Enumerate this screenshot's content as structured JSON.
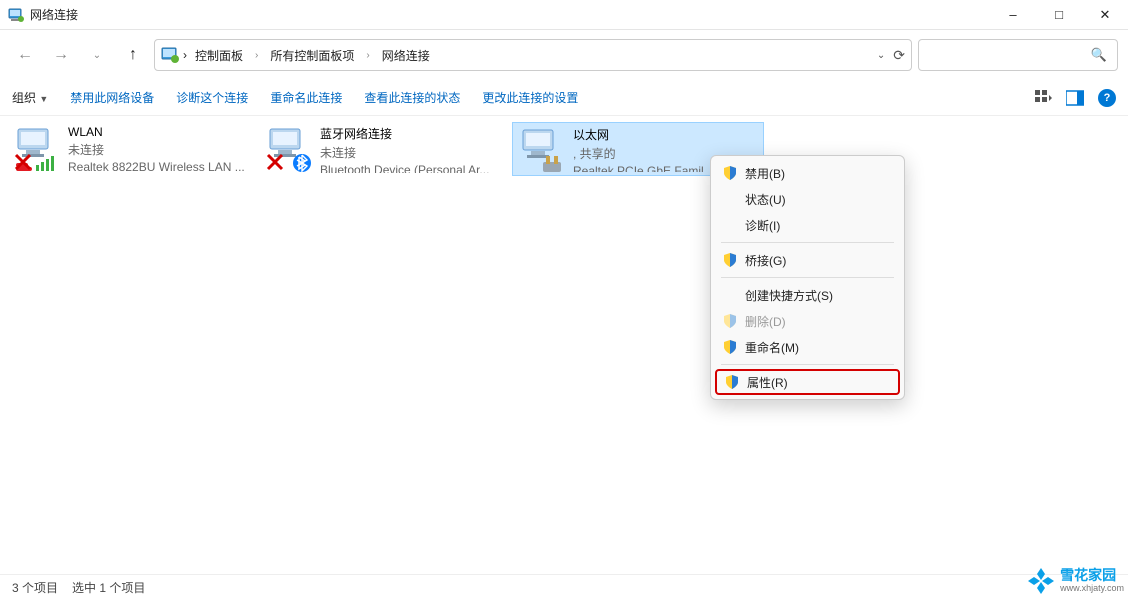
{
  "window": {
    "title": "网络连接"
  },
  "breadcrumb": {
    "root": "控制面板",
    "mid": "所有控制面板项",
    "leaf": "网络连接"
  },
  "toolbar": {
    "organize": "组织",
    "disable": "禁用此网络设备",
    "diagnose": "诊断这个连接",
    "rename": "重命名此连接",
    "status": "查看此连接的状态",
    "settings": "更改此连接的设置"
  },
  "connections": [
    {
      "name": "WLAN",
      "status": "未连接",
      "device": "Realtek 8822BU Wireless LAN ..."
    },
    {
      "name": "蓝牙网络连接",
      "status": "未连接",
      "device": "Bluetooth Device (Personal Ar..."
    },
    {
      "name": "以太网",
      "status": ", 共享的",
      "device": "Realtek PCIe GbE Famil..."
    }
  ],
  "ctx": {
    "disable": "禁用(B)",
    "status": "状态(U)",
    "diagnose": "诊断(I)",
    "bridge": "桥接(G)",
    "shortcut": "创建快捷方式(S)",
    "delete": "删除(D)",
    "rename": "重命名(M)",
    "properties": "属性(R)"
  },
  "statusbar": {
    "items": "3 个项目",
    "selected": "选中 1 个项目"
  },
  "watermark": {
    "name": "雪花家园",
    "url": "www.xhjaty.com"
  }
}
